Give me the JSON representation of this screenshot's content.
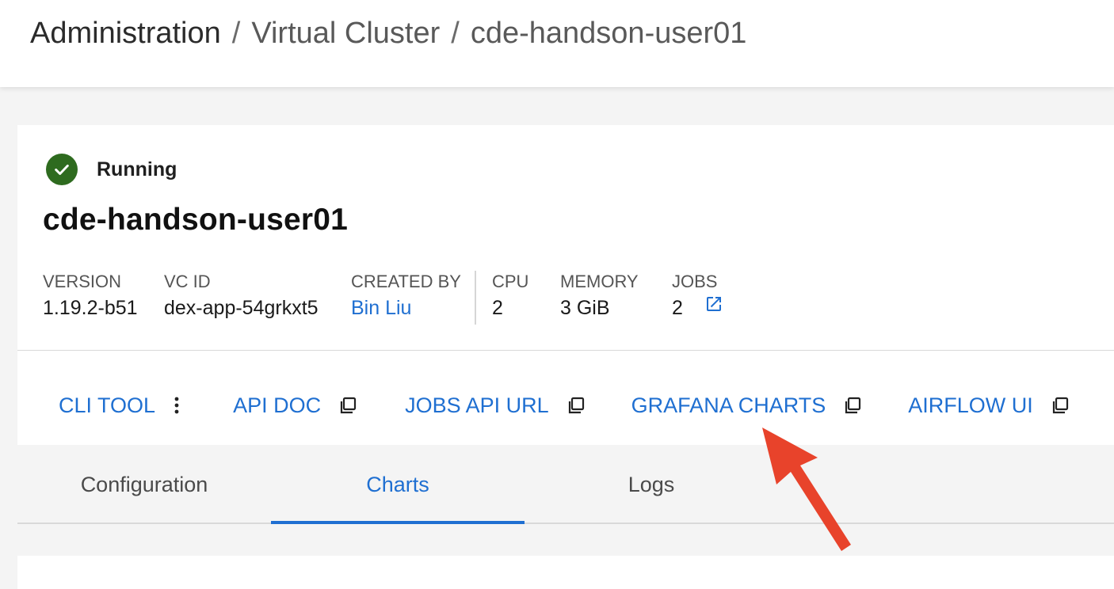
{
  "breadcrumb": {
    "items": [
      "Administration",
      "Virtual Cluster",
      "cde-handson-user01"
    ],
    "separator": "/"
  },
  "status": {
    "label": "Running",
    "icon": "check-circle-icon",
    "color": "#2e6b1f"
  },
  "cluster": {
    "name": "cde-handson-user01",
    "meta": [
      {
        "label": "VERSION",
        "value": "1.19.2-b51"
      },
      {
        "label": "VC ID",
        "value": "dex-app-54grkxt5"
      },
      {
        "label": "CREATED BY",
        "value": "Bin Liu"
      },
      {
        "label": "CPU",
        "value": "2"
      },
      {
        "label": "MEMORY",
        "value": "3 GiB"
      },
      {
        "label": "JOBS",
        "value": "2"
      }
    ]
  },
  "actions": [
    {
      "label": "CLI TOOL",
      "icon": "more-vertical-icon"
    },
    {
      "label": "API DOC",
      "icon": "copy-icon"
    },
    {
      "label": "JOBS API URL",
      "icon": "copy-icon"
    },
    {
      "label": "GRAFANA CHARTS",
      "icon": "copy-icon"
    },
    {
      "label": "AIRFLOW UI",
      "icon": "copy-icon"
    }
  ],
  "tabs": [
    {
      "label": "Configuration",
      "active": false
    },
    {
      "label": "Charts",
      "active": true
    },
    {
      "label": "Logs",
      "active": false
    }
  ],
  "colors": {
    "accent": "#1f6fd1",
    "annotation_arrow": "#e8432b"
  }
}
